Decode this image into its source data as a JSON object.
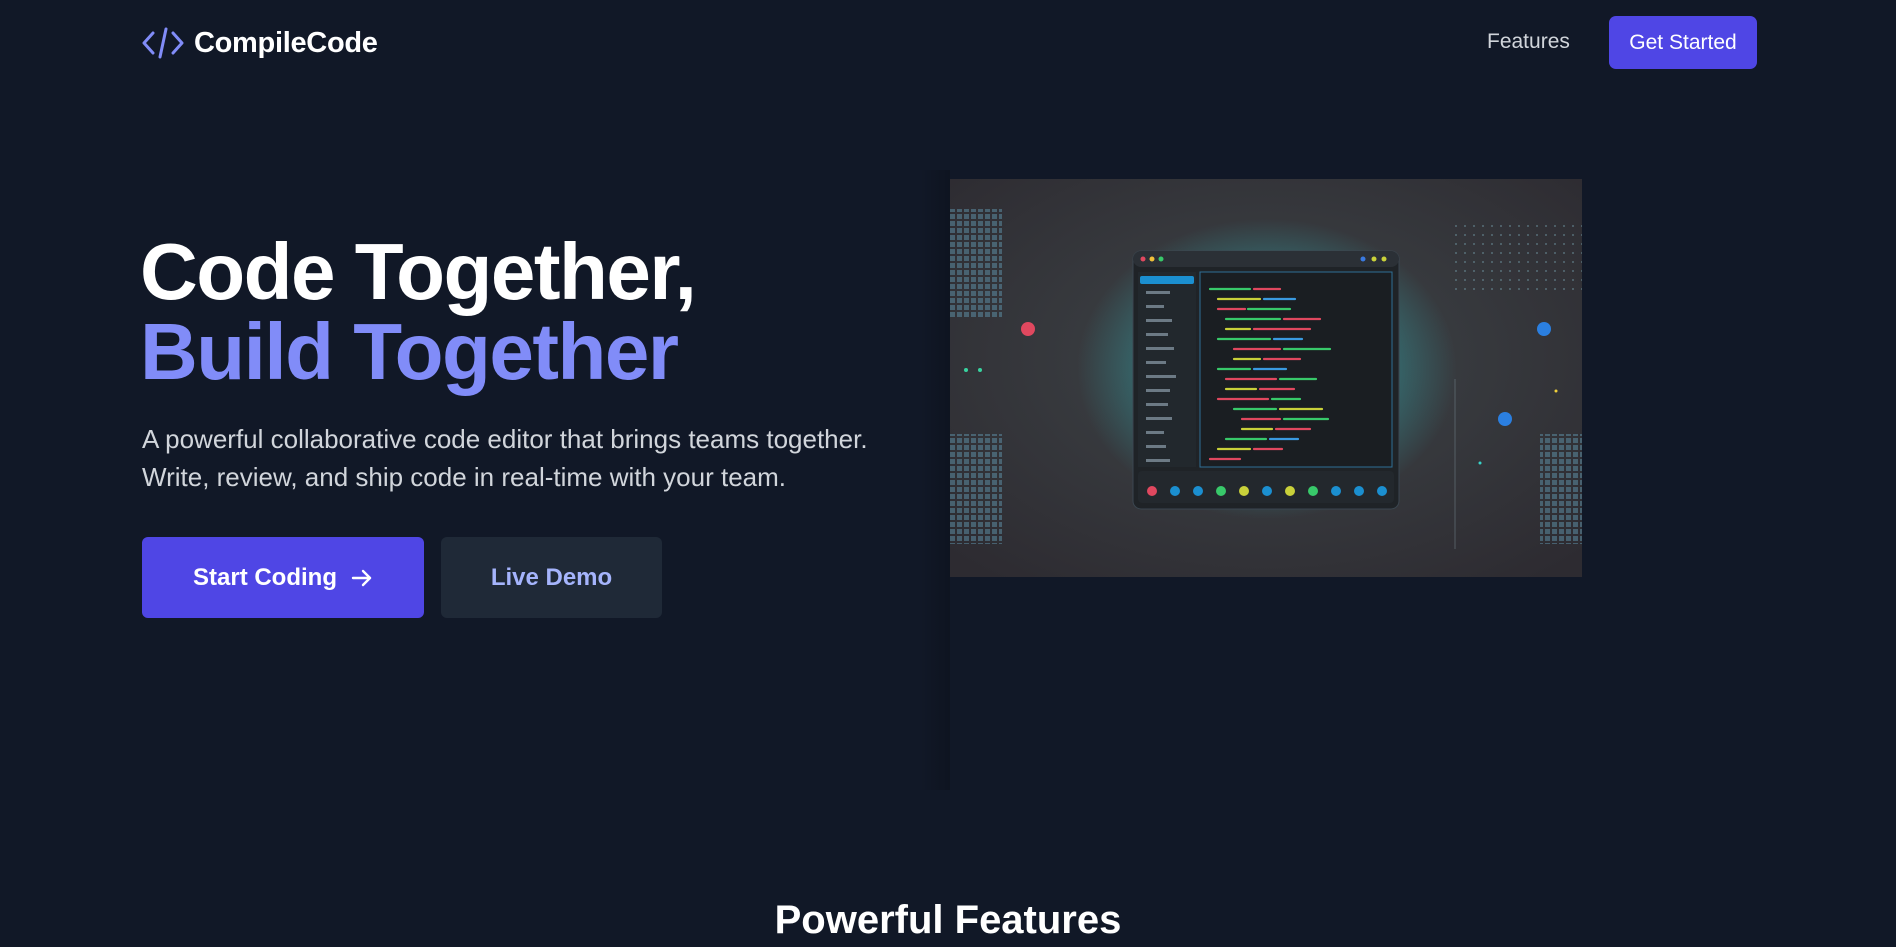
{
  "nav": {
    "brand_name": "CompileCode",
    "brand_icon": "code-brackets-icon",
    "features_link": "Features",
    "cta_label": "Get Started"
  },
  "hero": {
    "title_line1": "Code Together,",
    "title_line2": "Build Together",
    "subtitle_line1": "A powerful collaborative code editor that brings teams together.",
    "subtitle_line2": "Write, review, and ship code in real-time with your team.",
    "primary_button": "Start Coding",
    "primary_button_icon": "arrow-right-icon",
    "secondary_button": "Live Demo"
  },
  "features": {
    "heading": "Powerful Features"
  },
  "colors": {
    "background": "#111827",
    "accent": "#4f46e5",
    "accent_light": "#818cf8",
    "secondary_button_bg": "#1f2937",
    "text_muted": "#d1d5db"
  }
}
